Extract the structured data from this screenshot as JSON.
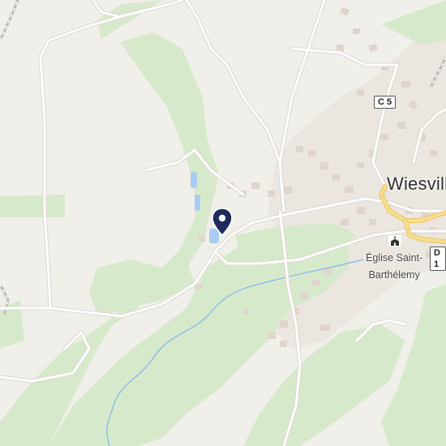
{
  "map": {
    "colors": {
      "background": "#f1efea",
      "forest": "#d8ebcc",
      "road": "#ffffff",
      "road_outline": "#e3ded6",
      "water": "#a9cdf0",
      "stream": "#8fbde8",
      "building": "#e4dad2",
      "town_area": "#e9e5df",
      "major_road": "#f5d98a",
      "marker": "#1f2a5c"
    },
    "town_label": "Wiesville",
    "poi": {
      "name_line1": "Église Saint-",
      "name_line2": "Barthélemy",
      "icon": "church-icon"
    },
    "road_shields": [
      {
        "ref": "C 5"
      },
      {
        "ref": "D 1"
      }
    ],
    "marker": {
      "icon": "location-pin-icon"
    }
  }
}
